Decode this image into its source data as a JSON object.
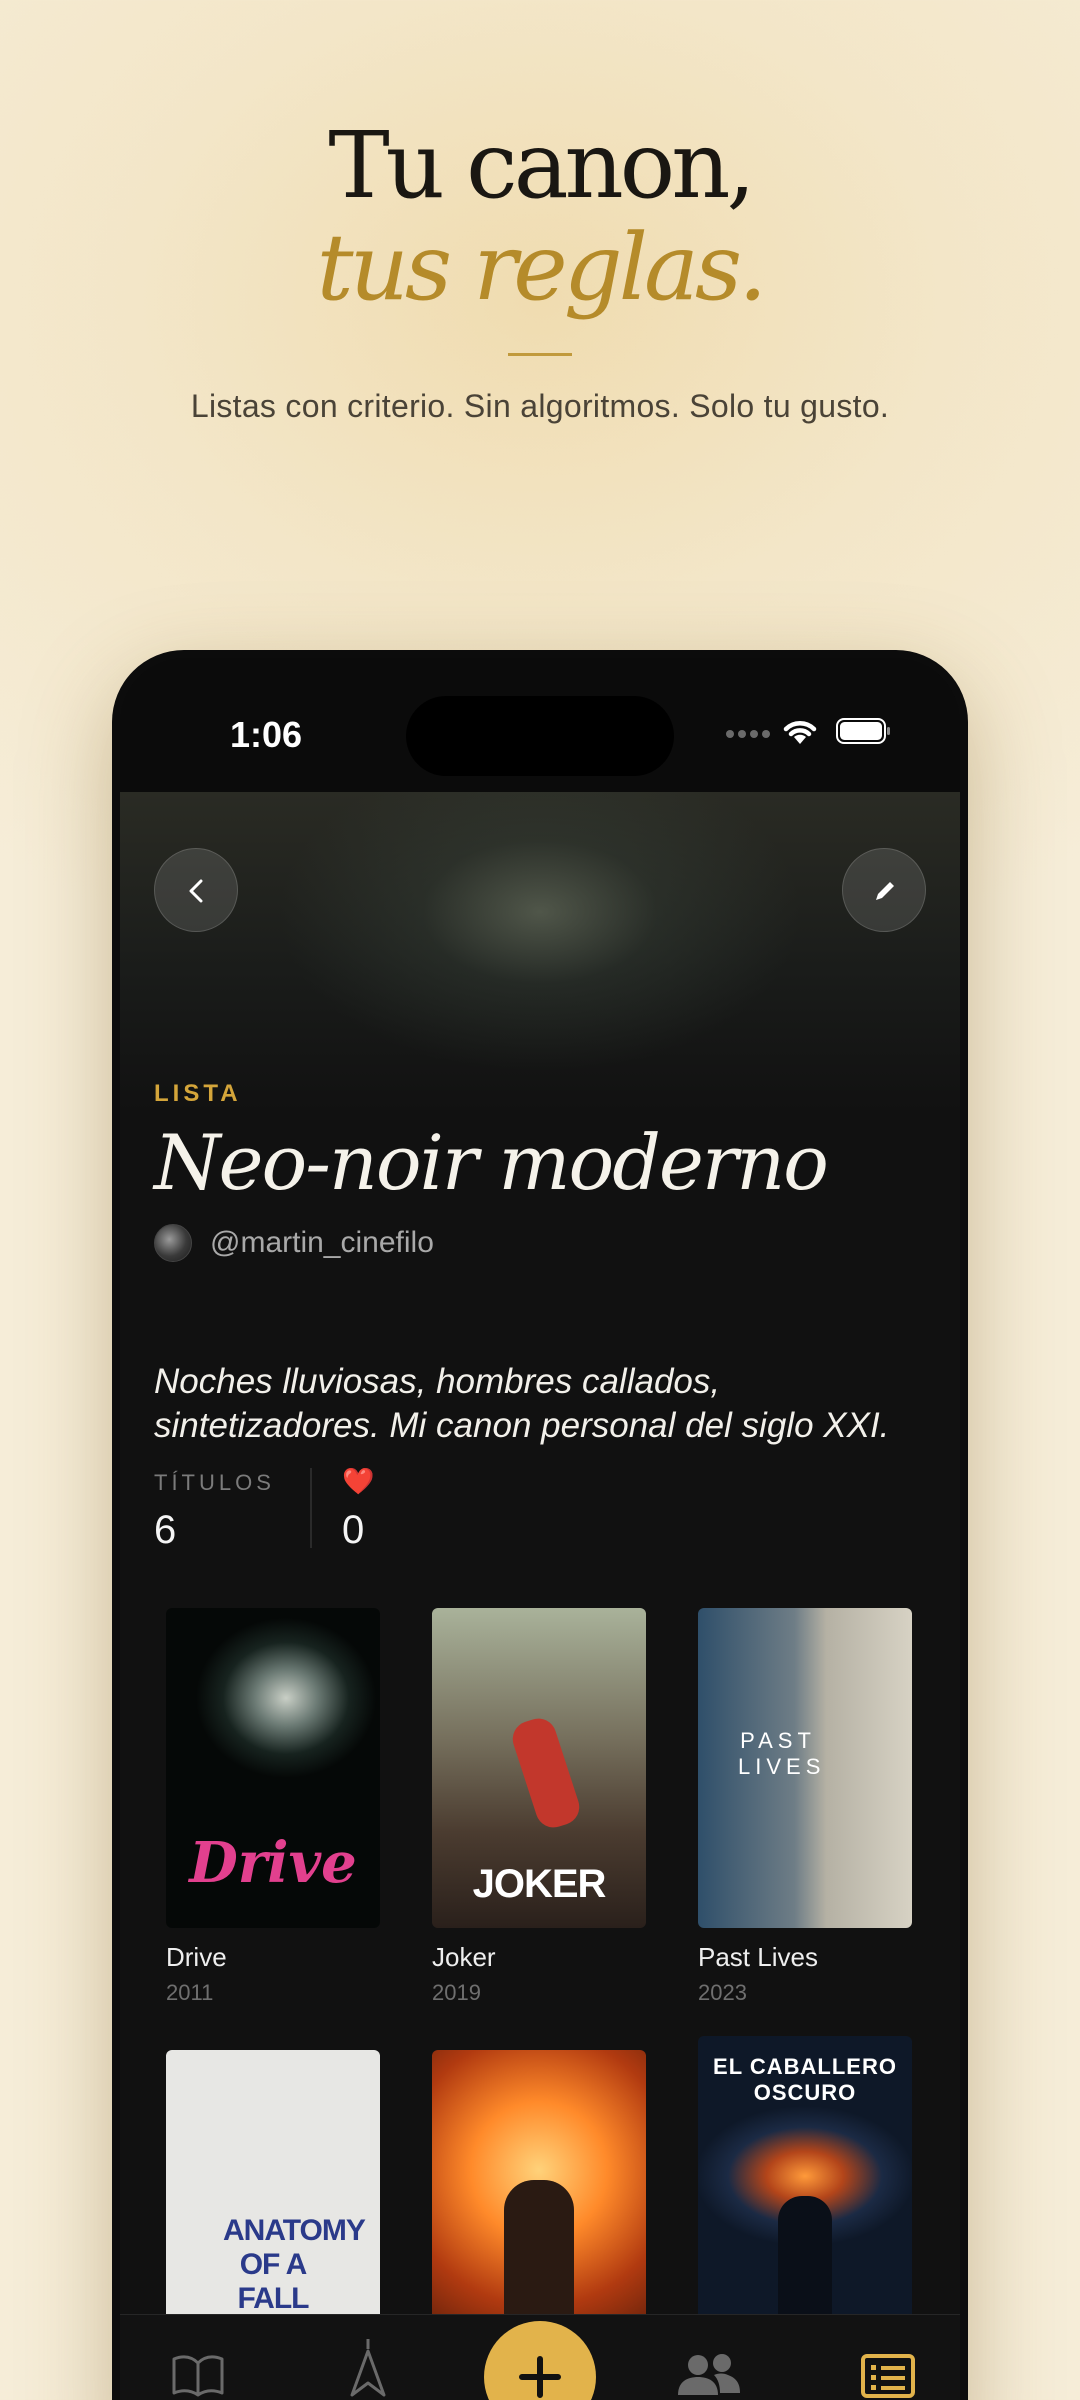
{
  "hero": {
    "title": "Tu canon,",
    "title_italic": "tus reglas.",
    "subtitle": "Listas con criterio. Sin algoritmos. Solo tu gusto."
  },
  "status_bar": {
    "time": "1:06"
  },
  "list": {
    "eyebrow": "LISTA",
    "title": "Neo-noir moderno",
    "author": "@martin_cinefilo",
    "description": "Noches lluviosas, hombres callados, sintetizadores. Mi canon personal del siglo XXI.",
    "stats": {
      "titles_label": "TÍTULOS",
      "titles_count": "6",
      "likes_icon": "❤️",
      "likes_count": "0"
    }
  },
  "films": [
    {
      "title": "Drive",
      "year": "2011",
      "poster_text": "Drive",
      "poster_color": "#e2408e"
    },
    {
      "title": "Joker",
      "year": "2019",
      "poster_text": "JOKER",
      "poster_color": "#ffffff"
    },
    {
      "title": "Past Lives",
      "year": "2023",
      "poster_text": "PAST LIVES",
      "poster_color": "#ffffff"
    },
    {
      "title": "",
      "year": "",
      "poster_text": "ANATOMY OF A FALL",
      "poster_color": "#2a3a8a"
    },
    {
      "title": "",
      "year": "",
      "poster_text": "",
      "poster_color": "#ff8a2a"
    },
    {
      "title": "",
      "year": "",
      "poster_text": "EL CABALLERO OSCURO",
      "poster_color": "#ffffff"
    }
  ],
  "tabbar": {
    "items": [
      "book-icon",
      "compass-icon",
      "add-icon",
      "people-icon",
      "lists-icon"
    ],
    "accent": "#e2b34b"
  }
}
